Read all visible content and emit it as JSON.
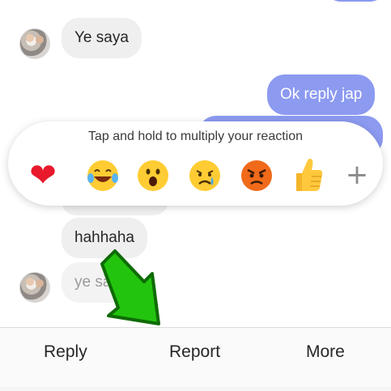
{
  "messages": {
    "in_1": "Ye saya",
    "out_1": "Ok reply jap",
    "in_2": "hahhaha",
    "in_3": "ye saya"
  },
  "reactions": {
    "hint": "Tap and hold to multiply your reaction",
    "items": [
      {
        "icon": "heart-icon",
        "glyph": "❤"
      },
      {
        "icon": "laughing-tears-icon",
        "glyph": "😂"
      },
      {
        "icon": "surprised-face-icon",
        "glyph": "😮"
      },
      {
        "icon": "crying-face-icon",
        "glyph": "😢"
      },
      {
        "icon": "angry-face-icon",
        "glyph": "😡"
      },
      {
        "icon": "thumbs-up-icon",
        "glyph": "👍"
      }
    ],
    "more_glyph": "+"
  },
  "actions": {
    "reply": "Reply",
    "report": "Report",
    "more": "More"
  },
  "colors": {
    "outgoing_bubble": "#8c9af0",
    "incoming_bubble": "#efefef",
    "arrow": "#22c40d"
  }
}
